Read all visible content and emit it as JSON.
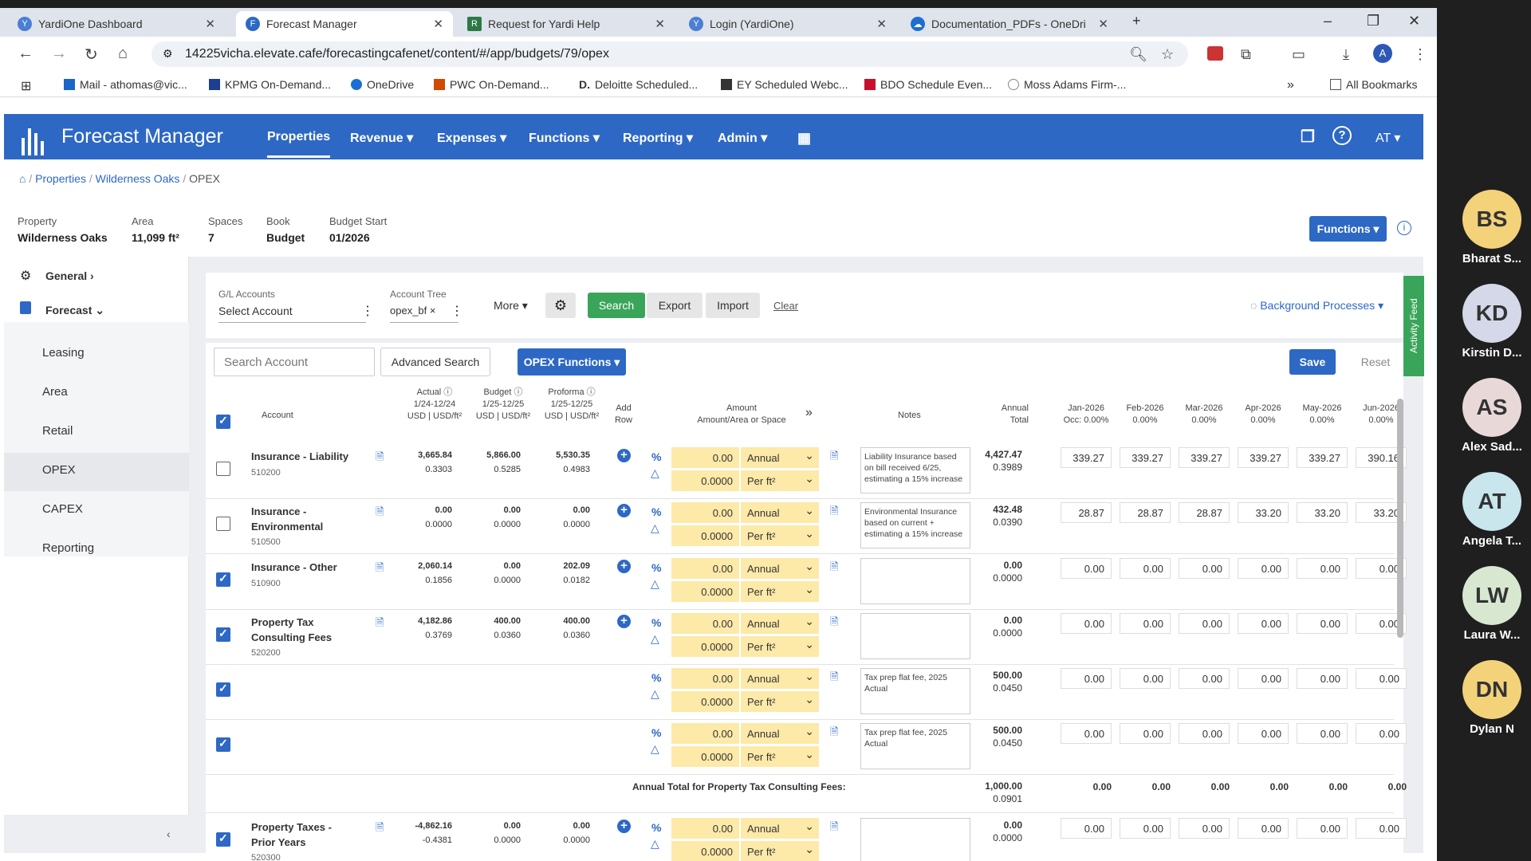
{
  "browser": {
    "tabs": [
      {
        "title": "YardiOne Dashboard",
        "color": "#4a7fd4"
      },
      {
        "title": "Forecast Manager",
        "color": "#2d68c4"
      },
      {
        "title": "Request for Yardi Help",
        "color": "#2b7a45"
      },
      {
        "title": "Login (YardiOne)",
        "color": "#4a7fd4"
      },
      {
        "title": "Documentation_PDFs - OneDri",
        "color": "#1c6fd0"
      }
    ],
    "url": "14225vicha.elevate.cafe/forecastingcafenet/content/#/app/budgets/79/opex",
    "profile": "A",
    "bookmarks": [
      "Mail - athomas@vic...",
      "KPMG On-Demand...",
      "OneDrive",
      "PWC On-Demand...",
      "Deloitte Scheduled...",
      "EY Scheduled Webc...",
      "BDO Schedule Even...",
      "Moss Adams Firm-...",
      "All Bookmarks"
    ]
  },
  "app": {
    "brand": "Forecast Manager",
    "menu": [
      "Properties",
      "Revenue",
      "Expenses",
      "Functions",
      "Reporting",
      "Admin"
    ],
    "user": "AT",
    "breadcrumb": [
      "Properties",
      "Wilderness Oaks",
      "OPEX"
    ]
  },
  "property": {
    "labels": [
      "Property",
      "Area",
      "Spaces",
      "Book",
      "Budget Start"
    ],
    "values": [
      "Wilderness Oaks",
      "11,099 ft²",
      "7",
      "Budget",
      "01/2026"
    ],
    "functions_btn": "Functions"
  },
  "sidebar": {
    "general": "General",
    "forecast": "Forecast",
    "items": [
      "Leasing",
      "Area",
      "Retail",
      "OPEX",
      "CAPEX",
      "Reporting"
    ]
  },
  "filters": {
    "gl_label": "G/L Accounts",
    "gl_value": "Select Account",
    "tree_label": "Account Tree",
    "tree_value": "opex_bf",
    "more": "More",
    "search": "Search",
    "export": "Export",
    "import": "Import",
    "clear": "Clear",
    "bg": "Background Processes",
    "activity": "Activity Feed"
  },
  "toolbar": {
    "search_placeholder": "Search Account",
    "advanced": "Advanced Search",
    "opex_functions": "OPEX Functions",
    "save": "Save",
    "reset": "Reset"
  },
  "table": {
    "headers": {
      "account": "Account",
      "actual": [
        "Actual ⓘ",
        "1/24-12/24",
        "USD | USD/ft²"
      ],
      "budget": [
        "Budget ⓘ",
        "1/25-12/25",
        "USD | USD/ft²"
      ],
      "proforma": [
        "Proforma ⓘ",
        "1/25-12/25",
        "USD | USD/ft²"
      ],
      "addrow": [
        "Add",
        "Row"
      ],
      "amount": [
        "Amount",
        "Amount/Area or Space"
      ],
      "notes": "Notes",
      "annual": [
        "Annual",
        "Total"
      ],
      "months": [
        [
          "Jan-2026",
          "Occ: 0.00%"
        ],
        [
          "Feb-2026",
          "0.00%"
        ],
        [
          "Mar-2026",
          "0.00%"
        ],
        [
          "Apr-2026",
          "0.00%"
        ],
        [
          "May-2026",
          "0.00%"
        ],
        [
          "Jun-2026",
          "0.00%"
        ]
      ]
    },
    "rows": [
      {
        "name": "Insurance - Liability",
        "code": "510200",
        "checked": false,
        "actual": [
          "3,665.84",
          "0.3303"
        ],
        "budget": [
          "5,866.00",
          "0.5285"
        ],
        "proforma": [
          "5,530.35",
          "0.4983"
        ],
        "amount": "0.00",
        "period": "Annual",
        "area": "0.0000",
        "unit": "Per ft²",
        "note": "Liability Insurance based on bill received 6/25, estimating a 15% increase",
        "annual": [
          "4,427.47",
          "0.3989"
        ],
        "months": [
          "339.27",
          "339.27",
          "339.27",
          "339.27",
          "339.27",
          "390.16"
        ]
      },
      {
        "name": "Insurance - Environmental",
        "code": "510500",
        "checked": false,
        "actual": [
          "0.00",
          "0.0000"
        ],
        "budget": [
          "0.00",
          "0.0000"
        ],
        "proforma": [
          "0.00",
          "0.0000"
        ],
        "amount": "0.00",
        "period": "Annual",
        "area": "0.0000",
        "unit": "Per ft²",
        "note": "Environmental Insurance based on current + estimating a 15% increase",
        "annual": [
          "432.48",
          "0.0390"
        ],
        "months": [
          "28.87",
          "28.87",
          "28.87",
          "33.20",
          "33.20",
          "33.20"
        ]
      },
      {
        "name": "Insurance - Other",
        "code": "510900",
        "checked": true,
        "actual": [
          "2,060.14",
          "0.1856"
        ],
        "budget": [
          "0.00",
          "0.0000"
        ],
        "proforma": [
          "202.09",
          "0.0182"
        ],
        "amount": "0.00",
        "period": "Annual",
        "area": "0.0000",
        "unit": "Per ft²",
        "note": "",
        "annual": [
          "0.00",
          "0.0000"
        ],
        "months": [
          "0.00",
          "0.00",
          "0.00",
          "0.00",
          "0.00",
          "0.00"
        ]
      },
      {
        "name": "Property Tax Consulting Fees",
        "code": "520200",
        "checked": true,
        "actual": [
          "4,182.86",
          "0.3769"
        ],
        "budget": [
          "400.00",
          "0.0360"
        ],
        "proforma": [
          "400.00",
          "0.0360"
        ],
        "amount": "0.00",
        "period": "Annual",
        "area": "0.0000",
        "unit": "Per ft²",
        "note": "",
        "annual": [
          "0.00",
          "0.0000"
        ],
        "months": [
          "0.00",
          "0.00",
          "0.00",
          "0.00",
          "0.00",
          "0.00"
        ]
      },
      {
        "name": "",
        "code": "",
        "checked": true,
        "actual": [
          "",
          ""
        ],
        "budget": [
          "",
          ""
        ],
        "proforma": [
          "",
          ""
        ],
        "amount": "0.00",
        "period": "Annual",
        "area": "0.0000",
        "unit": "Per ft²",
        "note": "Tax prep flat fee, 2025 Actual",
        "annual": [
          "500.00",
          "0.0450"
        ],
        "months": [
          "0.00",
          "0.00",
          "0.00",
          "0.00",
          "0.00",
          "0.00"
        ]
      },
      {
        "name": "",
        "code": "",
        "checked": true,
        "actual": [
          "",
          ""
        ],
        "budget": [
          "",
          ""
        ],
        "proforma": [
          "",
          ""
        ],
        "amount": "0.00",
        "period": "Annual",
        "area": "0.0000",
        "unit": "Per ft²",
        "note": "Tax prep flat fee, 2025 Actual",
        "annual": [
          "500.00",
          "0.0450"
        ],
        "months": [
          "0.00",
          "0.00",
          "0.00",
          "0.00",
          "0.00",
          "0.00"
        ]
      }
    ],
    "subtotal": {
      "label": "Annual Total for Property Tax Consulting Fees:",
      "annual": [
        "1,000.00",
        "0.0901"
      ],
      "months": [
        "0.00",
        "0.00",
        "0.00",
        "0.00",
        "0.00",
        "0.00"
      ]
    },
    "last": {
      "name": "Property Taxes - Prior Years",
      "code": "520300",
      "checked": true,
      "actual": [
        "-4,862.16",
        "-0.4381"
      ],
      "budget": [
        "0.00",
        "0.0000"
      ],
      "proforma": [
        "0.00",
        "0.0000"
      ],
      "amount": "0.00",
      "period": "Annual",
      "area": "0.0000",
      "unit": "Per ft²",
      "annual": [
        "0.00",
        "0.0000"
      ],
      "months": [
        "0.00",
        "0.00",
        "0.00",
        "0.00",
        "0.00",
        "0.00"
      ]
    }
  },
  "participants": [
    {
      "initials": "BS",
      "name": "Bharat S...",
      "color": "#f3d27a"
    },
    {
      "initials": "KD",
      "name": "Kirstin D...",
      "color": "#d4d8e8"
    },
    {
      "initials": "AS",
      "name": "Alex Sad...",
      "color": "#e8d8d8"
    },
    {
      "initials": "AT",
      "name": "Angela T...",
      "color": "#c8e6ec"
    },
    {
      "initials": "LW",
      "name": "Laura W...",
      "color": "#d8e8d0"
    },
    {
      "initials": "DN",
      "name": "Dylan N",
      "color": "#f3d27a"
    }
  ]
}
